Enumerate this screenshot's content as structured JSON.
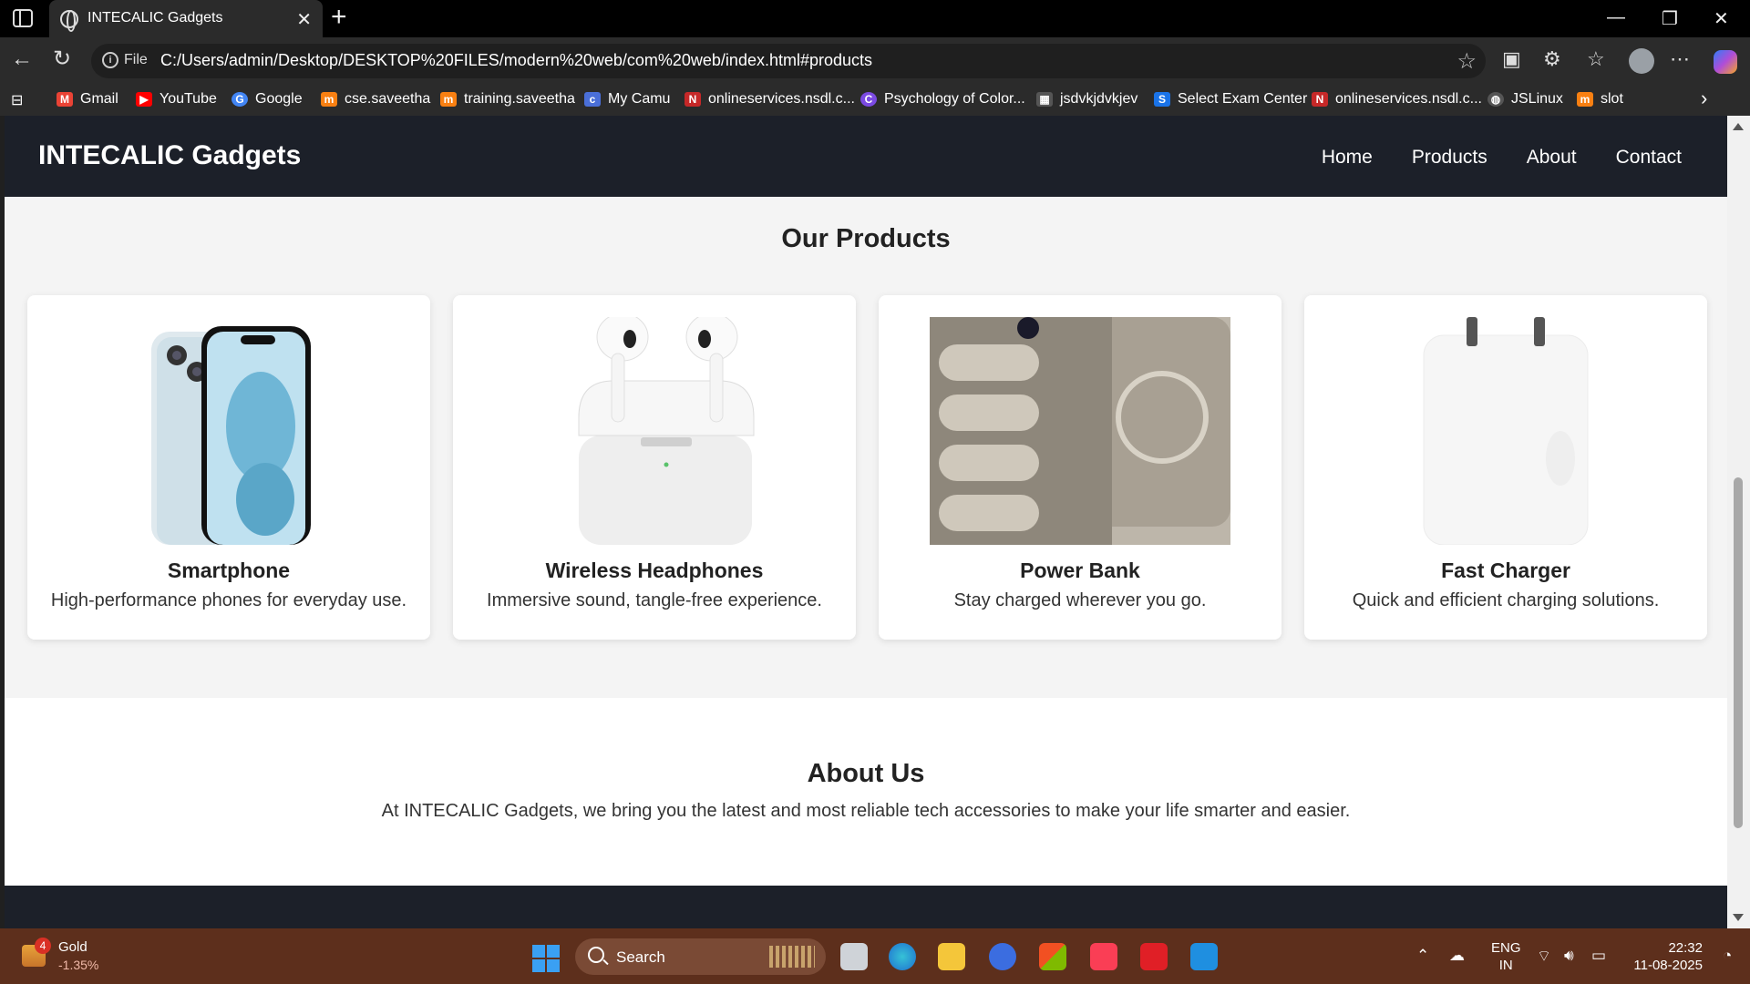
{
  "browser": {
    "tab_title": "INTECALIC Gadgets",
    "url_scheme": "File",
    "url": "C:/Users/admin/Desktop/DESKTOP%20FILES/modern%20web/com%20web/index.html#products",
    "bookmarks": [
      {
        "label": "Gmail",
        "icon": "gmail-icon",
        "color": "#ea4335"
      },
      {
        "label": "YouTube",
        "icon": "youtube-icon",
        "color": "#ff0000"
      },
      {
        "label": "Google",
        "icon": "google-icon",
        "color": "#4285f4"
      },
      {
        "label": "cse.saveetha",
        "icon": "moodle-icon",
        "color": "#f98012"
      },
      {
        "label": "training.saveetha",
        "icon": "moodle-icon",
        "color": "#f98012"
      },
      {
        "label": "My Camu",
        "icon": "camu-icon",
        "color": "#4a6fd8"
      },
      {
        "label": "onlineservices.nsdl.c...",
        "icon": "nsdl-icon",
        "color": "#c62828"
      },
      {
        "label": "Psychology of Color...",
        "icon": "canva-icon",
        "color": "#7b4ae2"
      },
      {
        "label": "jsdvkjdvkjev",
        "icon": "calendar-icon",
        "color": "#555555"
      },
      {
        "label": "Select Exam Center",
        "icon": "exam-icon",
        "color": "#1a73e8"
      },
      {
        "label": "onlineservices.nsdl.c...",
        "icon": "nsdl-icon",
        "color": "#c62828"
      },
      {
        "label": "JSLinux",
        "icon": "globe-icon",
        "color": "#555555"
      },
      {
        "label": "slot",
        "icon": "moodle-icon",
        "color": "#f98012"
      }
    ]
  },
  "site": {
    "brand": "INTECALIC Gadgets",
    "nav": [
      "Home",
      "Products",
      "About",
      "Contact"
    ],
    "products_title": "Our Products",
    "products": [
      {
        "name": "Smartphone",
        "desc": "High-performance phones for everyday use.",
        "image": "smartphone-image"
      },
      {
        "name": "Wireless Headphones",
        "desc": "Immersive sound, tangle-free experience.",
        "image": "earbuds-image"
      },
      {
        "name": "Power Bank",
        "desc": "Stay charged wherever you go.",
        "image": "power-bank-image"
      },
      {
        "name": "Fast Charger",
        "desc": "Quick and efficient charging solutions.",
        "image": "charger-image"
      }
    ],
    "about_title": "About Us",
    "about_text": "At INTECALIC Gadgets, we bring you the latest and most reliable tech accessories to make your life smarter and easier."
  },
  "taskbar": {
    "widget_badge": "4",
    "widget_name": "Gold",
    "widget_change": "-1.35%",
    "search_label": "Search",
    "lang_top": "ENG",
    "lang_bottom": "IN",
    "time": "22:32",
    "date": "11-08-2025"
  }
}
